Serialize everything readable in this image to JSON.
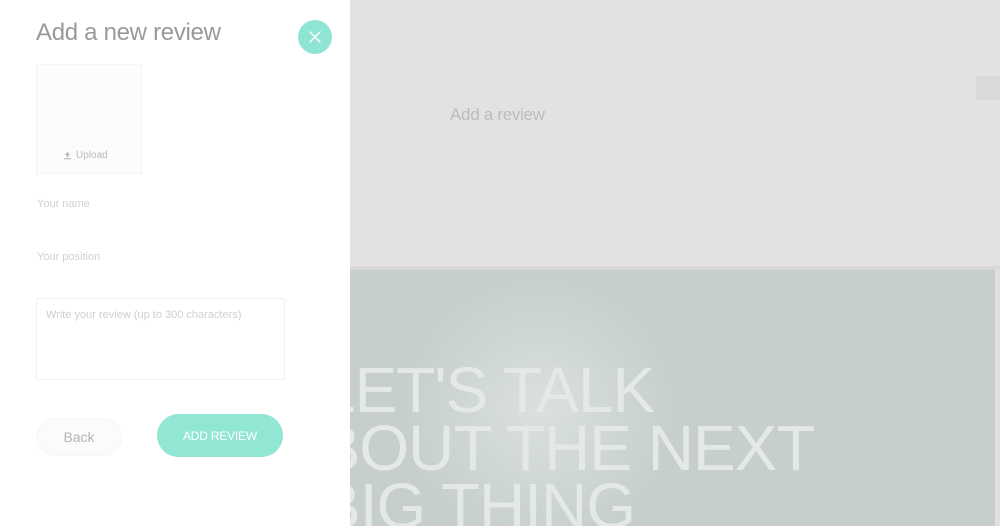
{
  "background": {
    "add_review_label": "Add a review",
    "hero_lines": [
      "LET'S TALK",
      "ABOUT THE NEXT",
      "BIG THING"
    ]
  },
  "modal": {
    "title": "Add a new review",
    "close_icon": "close-icon",
    "upload": {
      "label": "Upload",
      "icon": "upload-icon"
    },
    "name_label": "Your name",
    "position_label": "Your position",
    "review_placeholder": "Write your review (up to 300 characters)",
    "back_label": "Back",
    "submit_label": "ADD REVIEW"
  },
  "colors": {
    "accent": "#92e6d4",
    "overlay": "#e2e2e2",
    "hero_bg": "#c6cfcd"
  }
}
